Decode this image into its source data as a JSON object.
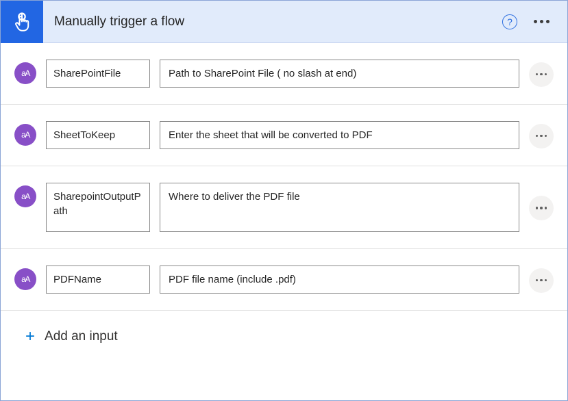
{
  "header": {
    "title": "Manually trigger a flow"
  },
  "inputs": [
    {
      "name": "SharePointFile",
      "placeholder": "Path to SharePoint File ( no slash at end)",
      "tall": false
    },
    {
      "name": "SheetToKeep",
      "placeholder": "Enter the sheet that will be converted to PDF",
      "tall": false
    },
    {
      "name": "SharepointOutputPath",
      "placeholder": "Where to deliver the PDF file",
      "tall": true
    },
    {
      "name": "PDFName",
      "placeholder": "PDF file name (include .pdf)",
      "tall": false
    }
  ],
  "footer": {
    "add_input": "Add an input"
  },
  "badge_text": "aA"
}
